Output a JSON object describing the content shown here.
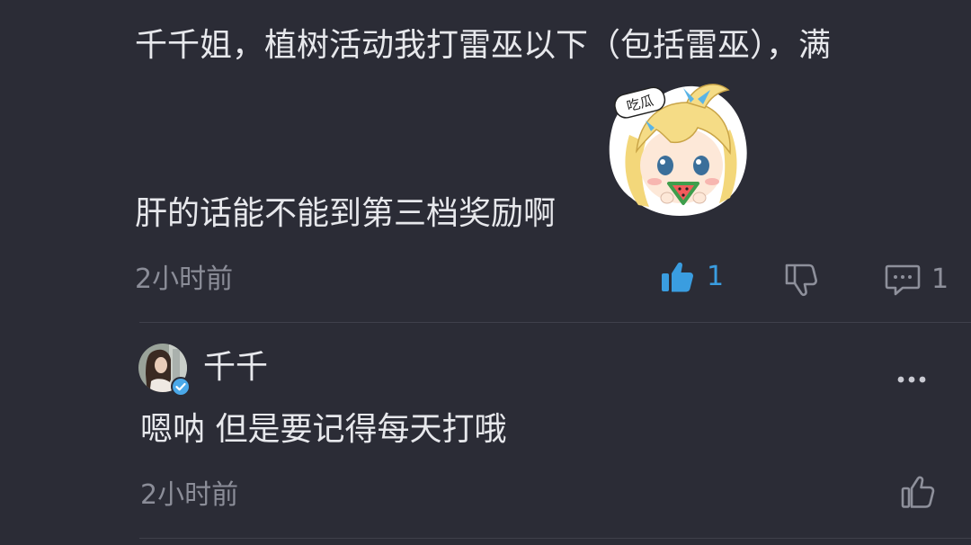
{
  "comment": {
    "text_line1": "千千姐，植树活动我打雷巫以下（包括雷巫），满",
    "text_line2": "肝的话能不能到第三档奖励啊",
    "sticker_caption": "吃瓜",
    "timestamp": "2小时前",
    "like_count": "1",
    "reply_count": "1"
  },
  "reply": {
    "username": "千千",
    "text": "嗯呐 但是要记得每天打哦",
    "timestamp": "2小时前"
  },
  "icons": {
    "like": "thumbs-up-icon",
    "dislike": "thumbs-down-icon",
    "reply": "comment-bubble-icon",
    "more": "more-dots-icon",
    "verified": "verified-badge-icon"
  },
  "colors": {
    "background": "#2b2c36",
    "text": "#e7e8ec",
    "muted": "#8b8d98",
    "accent_like": "#3a9de0",
    "divider": "#3f404b",
    "verified": "#4aa8e8"
  }
}
